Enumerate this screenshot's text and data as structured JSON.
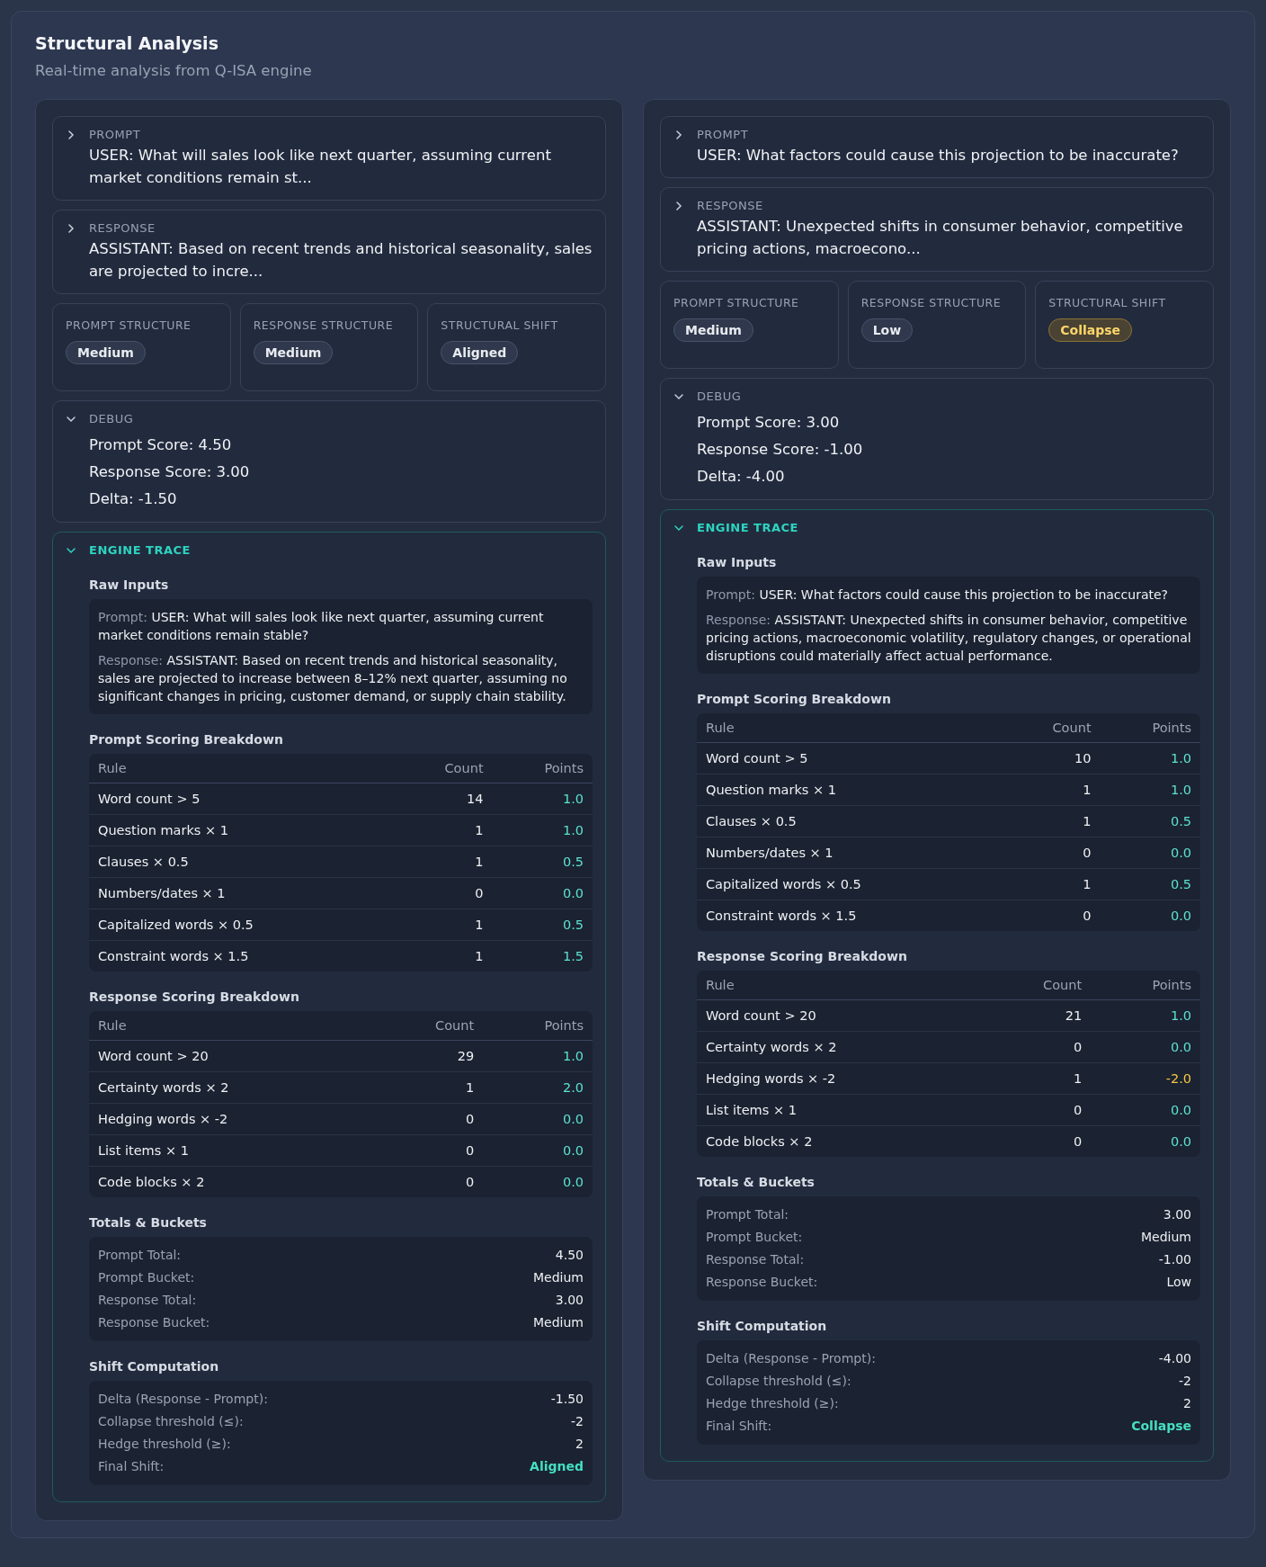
{
  "header": {
    "title": "Structural Analysis",
    "subtitle": "Real-time analysis from Q-ISA engine"
  },
  "panels": [
    {
      "prompt": {
        "label": "PROMPT",
        "text": "USER: What will sales look like next quarter, assuming current market conditions remain st...",
        "expanded": false
      },
      "response": {
        "label": "RESPONSE",
        "text": "ASSISTANT: Based on recent trends and historical seasonality, sales are projected to incre...",
        "expanded": false
      },
      "structures": [
        {
          "label": "PROMPT STRUCTURE",
          "value": "Medium",
          "kind": "neutral"
        },
        {
          "label": "RESPONSE STRUCTURE",
          "value": "Medium",
          "kind": "neutral"
        },
        {
          "label": "STRUCTURAL SHIFT",
          "value": "Aligned",
          "kind": "neutral"
        }
      ],
      "debug": {
        "label": "DEBUG",
        "expanded": true,
        "lines": [
          "Prompt Score: 4.50",
          "Response Score: 3.00",
          "Delta: -1.50"
        ]
      },
      "trace": {
        "label": "ENGINE TRACE",
        "expanded": true,
        "raw_inputs": {
          "title": "Raw Inputs",
          "items": [
            {
              "label": "Prompt:",
              "text": "USER: What will sales look like next quarter, assuming current market conditions remain stable?"
            },
            {
              "label": "Response:",
              "text": "ASSISTANT: Based on recent trends and historical seasonality, sales are projected to increase between 8–12% next quarter, assuming no significant changes in pricing, customer demand, or supply chain stability."
            }
          ]
        },
        "tables": [
          {
            "title": "Prompt Scoring Breakdown",
            "columns": [
              "Rule",
              "Count",
              "Points"
            ],
            "rows": [
              {
                "rule": "Word count > 5",
                "count": "14",
                "points": "1.0",
                "color": "#5ce1d0"
              },
              {
                "rule": "Question marks × 1",
                "count": "1",
                "points": "1.0",
                "color": "#5ce1d0"
              },
              {
                "rule": "Clauses × 0.5",
                "count": "1",
                "points": "0.5",
                "color": "#5ce1d0"
              },
              {
                "rule": "Numbers/dates × 1",
                "count": "0",
                "points": "0.0",
                "color": "#5ce1d0"
              },
              {
                "rule": "Capitalized words × 0.5",
                "count": "1",
                "points": "0.5",
                "color": "#5ce1d0"
              },
              {
                "rule": "Constraint words × 1.5",
                "count": "1",
                "points": "1.5",
                "color": "#5ce1d0"
              }
            ]
          },
          {
            "title": "Response Scoring Breakdown",
            "columns": [
              "Rule",
              "Count",
              "Points"
            ],
            "rows": [
              {
                "rule": "Word count > 20",
                "count": "29",
                "points": "1.0",
                "color": "#5ce1d0"
              },
              {
                "rule": "Certainty words × 2",
                "count": "1",
                "points": "2.0",
                "color": "#5ce1d0"
              },
              {
                "rule": "Hedging words × -2",
                "count": "0",
                "points": "0.0",
                "color": "#5ce1d0"
              },
              {
                "rule": "List items × 1",
                "count": "0",
                "points": "0.0",
                "color": "#5ce1d0"
              },
              {
                "rule": "Code blocks × 2",
                "count": "0",
                "points": "0.0",
                "color": "#5ce1d0"
              }
            ]
          }
        ],
        "totals": {
          "title": "Totals & Buckets",
          "rows": [
            {
              "label": "Prompt Total:",
              "value": "4.50"
            },
            {
              "label": "Prompt Bucket:",
              "value": "Medium"
            },
            {
              "label": "Response Total:",
              "value": "3.00"
            },
            {
              "label": "Response Bucket:",
              "value": "Medium"
            }
          ]
        },
        "shift": {
          "title": "Shift Computation",
          "rows": [
            {
              "label": "Delta (Response - Prompt):",
              "value": "-1.50",
              "kind": "plain"
            },
            {
              "label": "Collapse threshold (≤):",
              "value": "-2",
              "kind": "plain"
            },
            {
              "label": "Hedge threshold (≥):",
              "value": "2",
              "kind": "plain"
            },
            {
              "label": "Final Shift:",
              "value": "Aligned",
              "kind": "result"
            }
          ]
        }
      }
    },
    {
      "prompt": {
        "label": "PROMPT",
        "text": "USER: What factors could cause this projection to be inaccurate?",
        "expanded": false
      },
      "response": {
        "label": "RESPONSE",
        "text": "ASSISTANT: Unexpected shifts in consumer behavior, competitive pricing actions, macroecono...",
        "expanded": false
      },
      "structures": [
        {
          "label": "PROMPT STRUCTURE",
          "value": "Medium",
          "kind": "neutral"
        },
        {
          "label": "RESPONSE STRUCTURE",
          "value": "Low",
          "kind": "neutral"
        },
        {
          "label": "STRUCTURAL SHIFT",
          "value": "Collapse",
          "kind": "warning"
        }
      ],
      "debug": {
        "label": "DEBUG",
        "expanded": true,
        "lines": [
          "Prompt Score: 3.00",
          "Response Score: -1.00",
          "Delta: -4.00"
        ]
      },
      "trace": {
        "label": "ENGINE TRACE",
        "expanded": true,
        "raw_inputs": {
          "title": "Raw Inputs",
          "items": [
            {
              "label": "Prompt:",
              "text": "USER: What factors could cause this projection to be inaccurate?"
            },
            {
              "label": "Response:",
              "text": "ASSISTANT: Unexpected shifts in consumer behavior, competitive pricing actions, macroeconomic volatility, regulatory changes, or operational disruptions could materially affect actual performance."
            }
          ]
        },
        "tables": [
          {
            "title": "Prompt Scoring Breakdown",
            "columns": [
              "Rule",
              "Count",
              "Points"
            ],
            "rows": [
              {
                "rule": "Word count > 5",
                "count": "10",
                "points": "1.0",
                "color": "#5ce1d0"
              },
              {
                "rule": "Question marks × 1",
                "count": "1",
                "points": "1.0",
                "color": "#5ce1d0"
              },
              {
                "rule": "Clauses × 0.5",
                "count": "1",
                "points": "0.5",
                "color": "#5ce1d0"
              },
              {
                "rule": "Numbers/dates × 1",
                "count": "0",
                "points": "0.0",
                "color": "#5ce1d0"
              },
              {
                "rule": "Capitalized words × 0.5",
                "count": "1",
                "points": "0.5",
                "color": "#5ce1d0"
              },
              {
                "rule": "Constraint words × 1.5",
                "count": "0",
                "points": "0.0",
                "color": "#5ce1d0"
              }
            ]
          },
          {
            "title": "Response Scoring Breakdown",
            "columns": [
              "Rule",
              "Count",
              "Points"
            ],
            "rows": [
              {
                "rule": "Word count > 20",
                "count": "21",
                "points": "1.0",
                "color": "#5ce1d0"
              },
              {
                "rule": "Certainty words × 2",
                "count": "0",
                "points": "0.0",
                "color": "#5ce1d0"
              },
              {
                "rule": "Hedging words × -2",
                "count": "1",
                "points": "-2.0",
                "color": "#f5c542"
              },
              {
                "rule": "List items × 1",
                "count": "0",
                "points": "0.0",
                "color": "#5ce1d0"
              },
              {
                "rule": "Code blocks × 2",
                "count": "0",
                "points": "0.0",
                "color": "#5ce1d0"
              }
            ]
          }
        ],
        "totals": {
          "title": "Totals & Buckets",
          "rows": [
            {
              "label": "Prompt Total:",
              "value": "3.00"
            },
            {
              "label": "Prompt Bucket:",
              "value": "Medium"
            },
            {
              "label": "Response Total:",
              "value": "-1.00"
            },
            {
              "label": "Response Bucket:",
              "value": "Low"
            }
          ]
        },
        "shift": {
          "title": "Shift Computation",
          "rows": [
            {
              "label": "Delta (Response - Prompt):",
              "value": "-4.00",
              "kind": "plain"
            },
            {
              "label": "Collapse threshold (≤):",
              "value": "-2",
              "kind": "plain"
            },
            {
              "label": "Hedge threshold (≥):",
              "value": "2",
              "kind": "plain"
            },
            {
              "label": "Final Shift:",
              "value": "Collapse",
              "kind": "result"
            }
          ]
        }
      }
    }
  ]
}
